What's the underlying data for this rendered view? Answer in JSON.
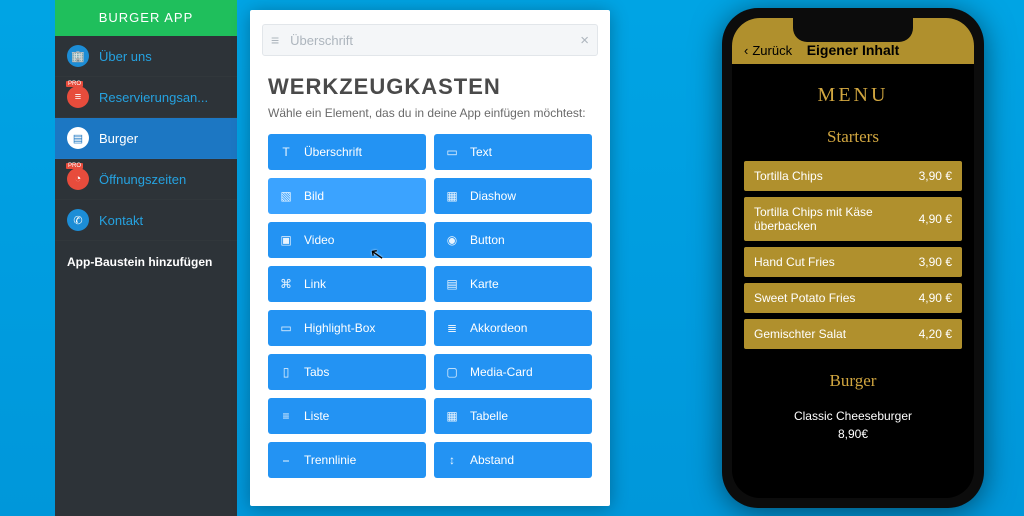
{
  "sidebar": {
    "header": "BURGER APP",
    "items": [
      {
        "label": "Über uns",
        "icon_name": "building-icon"
      },
      {
        "label": "Reservierungsan...",
        "icon_name": "list-icon",
        "pro": "PRO"
      },
      {
        "label": "Burger",
        "icon_name": "page-icon",
        "active": true
      },
      {
        "label": "Öffnungszeiten",
        "icon_name": "clock-icon",
        "pro": "PRO"
      },
      {
        "label": "Kontakt",
        "icon_name": "phone-icon"
      }
    ],
    "add_label": "App-Baustein hinzufügen"
  },
  "editor": {
    "top_placeholder": "Überschrift",
    "title": "WERKZEUGKASTEN",
    "subtitle": "Wähle ein Element, das du in deine App einfügen möchtest:",
    "tools_left": [
      "Überschrift",
      "Bild",
      "Video",
      "Link",
      "Highlight-Box",
      "Tabs",
      "Liste",
      "Trennlinie"
    ],
    "tools_right": [
      "Text",
      "Diashow",
      "Button",
      "Karte",
      "Akkordeon",
      "Media-Card",
      "Tabelle",
      "Abstand"
    ]
  },
  "phone": {
    "back": "Zurück",
    "title": "Eigener Inhalt",
    "menu_heading": "MENU",
    "sections": [
      {
        "heading": "Starters",
        "items": [
          {
            "name": "Tortilla Chips",
            "price": "3,90 €"
          },
          {
            "name": "Tortilla Chips mit Käse überbacken",
            "price": "4,90 €"
          },
          {
            "name": "Hand Cut Fries",
            "price": "3,90 €"
          },
          {
            "name": "Sweet Potato Fries",
            "price": "4,90 €"
          },
          {
            "name": "Gemischter Salat",
            "price": "4,20 €"
          }
        ]
      },
      {
        "heading": "Burger",
        "plain_items": [
          {
            "name": "Classic Cheeseburger",
            "price": "8,90€"
          }
        ]
      }
    ]
  }
}
